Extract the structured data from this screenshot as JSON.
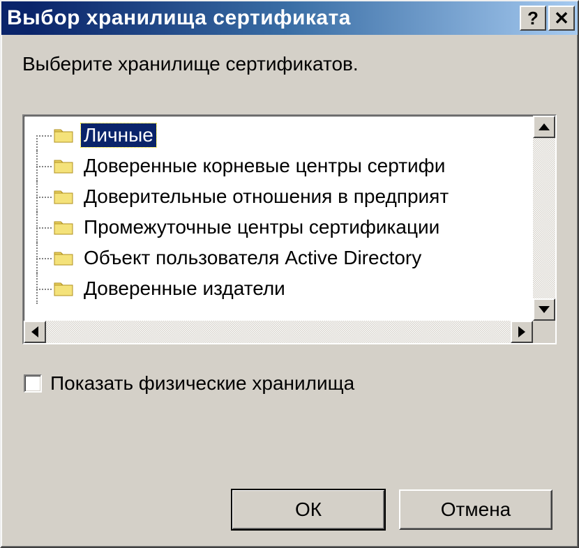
{
  "window": {
    "title": "Выбор хранилища сертификата"
  },
  "prompt": "Выберите хранилище сертификатов.",
  "tree": {
    "items": [
      {
        "label": "Личные",
        "selected": true
      },
      {
        "label": "Доверенные корневые центры сертифи",
        "selected": false
      },
      {
        "label": "Доверительные отношения в предприят",
        "selected": false
      },
      {
        "label": "Промежуточные центры сертификации",
        "selected": false
      },
      {
        "label": "Объект пользователя Active Directory",
        "selected": false
      },
      {
        "label": "Доверенные издатели",
        "selected": false
      }
    ]
  },
  "checkbox": {
    "label": "Показать физические хранилища",
    "checked": false
  },
  "buttons": {
    "ok": "ОК",
    "cancel": "Отмена"
  }
}
